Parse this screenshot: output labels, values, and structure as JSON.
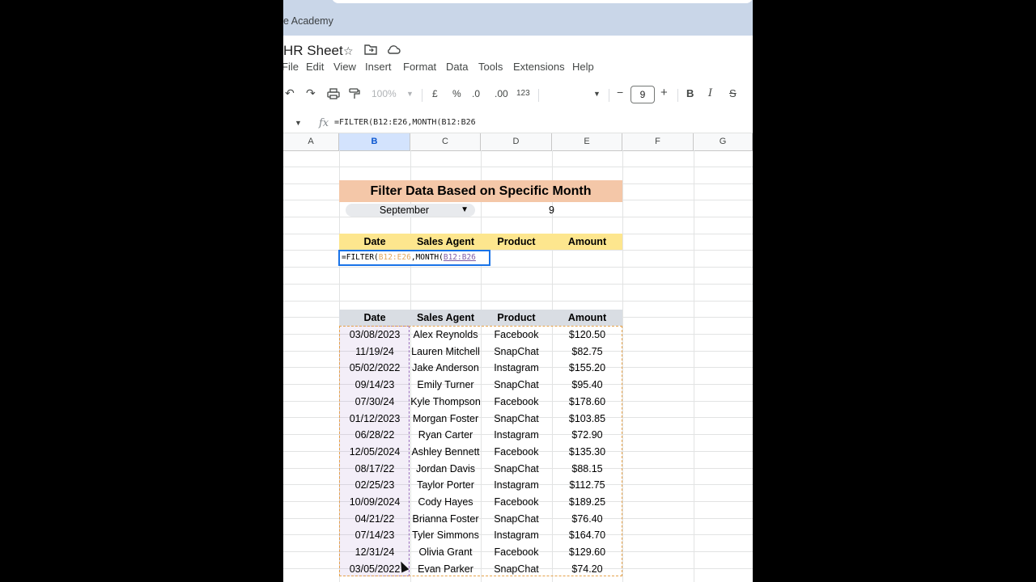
{
  "browser": {
    "tab_title": "e Academy"
  },
  "doc": {
    "title": "HR Sheet"
  },
  "menu": [
    "File",
    "Edit",
    "View",
    "Insert",
    "Format",
    "Data",
    "Tools",
    "Extensions",
    "Help"
  ],
  "toolbar": {
    "zoom": "100%",
    "currency": "£",
    "percent": "%",
    "dec_less": ".0",
    "dec_more": ".00",
    "format_123": "123",
    "font_size": "9",
    "bold": "B",
    "italic": "I",
    "strike": "S"
  },
  "formula_bar": {
    "prefix": "=FILTER(",
    "range_b": "B12:E26",
    "mid": ",MONTH(",
    "range_c": "B12:B26"
  },
  "columns": [
    "A",
    "B",
    "C",
    "D",
    "E",
    "F",
    "G"
  ],
  "selected_column": "B",
  "filter_section": {
    "title": "Filter Data Based on Specific Month",
    "month_label": "September",
    "month_number": "9",
    "headers": [
      "Date",
      "Sales Agent",
      "Product",
      "Amount"
    ]
  },
  "source_table": {
    "headers": [
      "Date",
      "Sales Agent",
      "Product",
      "Amount"
    ],
    "rows": [
      [
        "03/08/2023",
        "Alex Reynolds",
        "Facebook",
        "$120.50"
      ],
      [
        "11/19/24",
        "Lauren Mitchell",
        "SnapChat",
        "$82.75"
      ],
      [
        "05/02/2022",
        "Jake Anderson",
        "Instagram",
        "$155.20"
      ],
      [
        "09/14/23",
        "Emily Turner",
        "SnapChat",
        "$95.40"
      ],
      [
        "07/30/24",
        "Kyle Thompson",
        "Facebook",
        "$178.60"
      ],
      [
        "01/12/2023",
        "Morgan Foster",
        "SnapChat",
        "$103.85"
      ],
      [
        "06/28/22",
        "Ryan Carter",
        "Instagram",
        "$72.90"
      ],
      [
        "12/05/2024",
        "Ashley Bennett",
        "Facebook",
        "$135.30"
      ],
      [
        "08/17/22",
        "Jordan Davis",
        "SnapChat",
        "$88.15"
      ],
      [
        "02/25/23",
        "Taylor Porter",
        "Instagram",
        "$112.75"
      ],
      [
        "10/09/2024",
        "Cody Hayes",
        "Facebook",
        "$189.25"
      ],
      [
        "04/21/22",
        "Brianna Foster",
        "SnapChat",
        "$76.40"
      ],
      [
        "07/14/23",
        "Tyler Simmons",
        "Instagram",
        "$164.70"
      ],
      [
        "12/31/24",
        "Olivia Grant",
        "Facebook",
        "$129.60"
      ],
      [
        "03/05/2022",
        "Evan Parker",
        "SnapChat",
        "$74.20"
      ]
    ]
  },
  "colors": {
    "title_bg": "#f4c7a8",
    "header_yellow": "#fde68e",
    "header_gray": "#d9dde3",
    "selection": "#1a73e8"
  }
}
